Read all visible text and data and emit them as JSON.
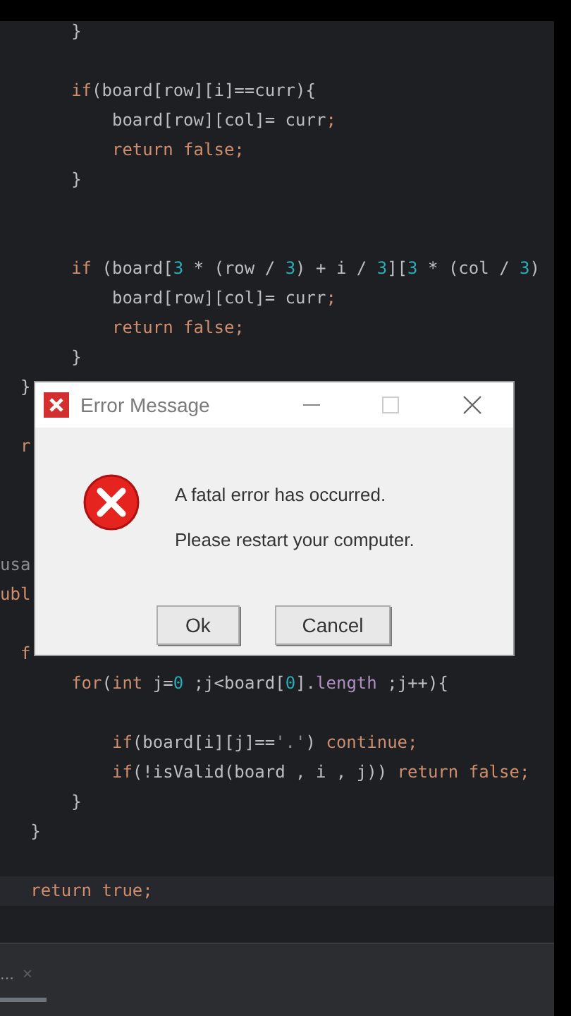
{
  "editor": {
    "lines": [
      {
        "current": false,
        "tokens": [
          {
            "text": "       }",
            "kind": "plain"
          }
        ]
      },
      {
        "current": false
      },
      {
        "current": false,
        "tokens": [
          {
            "text": "       if",
            "kind": "keyword"
          },
          {
            "text": "(board[row][i]==curr){",
            "kind": "plain"
          }
        ]
      },
      {
        "current": false,
        "tokens": [
          {
            "text": "           board[row][col]= curr",
            "kind": "plain"
          },
          {
            "text": ";",
            "kind": "keyword"
          }
        ]
      },
      {
        "current": false,
        "tokens": [
          {
            "text": "           return false;",
            "kind": "keyword"
          }
        ]
      },
      {
        "current": false,
        "tokens": [
          {
            "text": "       }",
            "kind": "plain"
          }
        ]
      },
      {
        "current": false
      },
      {
        "current": false
      },
      {
        "current": false,
        "tokens": [
          {
            "text": "       if",
            "kind": "keyword"
          },
          {
            "text": " (board[",
            "kind": "plain"
          },
          {
            "text": "3",
            "kind": "number"
          },
          {
            "text": " * (row / ",
            "kind": "plain"
          },
          {
            "text": "3",
            "kind": "number"
          },
          {
            "text": ") + i / ",
            "kind": "plain"
          },
          {
            "text": "3",
            "kind": "number"
          },
          {
            "text": "][",
            "kind": "plain"
          },
          {
            "text": "3",
            "kind": "number"
          },
          {
            "text": " * (col / ",
            "kind": "plain"
          },
          {
            "text": "3",
            "kind": "number"
          },
          {
            "text": ")",
            "kind": "plain"
          }
        ]
      },
      {
        "current": false,
        "tokens": [
          {
            "text": "           board[row][col]= curr",
            "kind": "plain"
          },
          {
            "text": ";",
            "kind": "keyword"
          }
        ]
      },
      {
        "current": false,
        "tokens": [
          {
            "text": "           return false;",
            "kind": "keyword"
          }
        ]
      },
      {
        "current": false,
        "tokens": [
          {
            "text": "       }",
            "kind": "plain"
          }
        ]
      },
      {
        "current": false,
        "tokens": [
          {
            "text": "  }",
            "kind": "plain"
          }
        ]
      },
      {
        "current": false
      },
      {
        "current": false,
        "tokens": [
          {
            "text": "  r",
            "kind": "keyword"
          }
        ]
      },
      {
        "current": false
      },
      {
        "current": false
      },
      {
        "current": false
      },
      {
        "current": false,
        "tokens": [
          {
            "text": "usa",
            "kind": "hint"
          }
        ]
      },
      {
        "current": false,
        "tokens": [
          {
            "text": "ubl",
            "kind": "keyword"
          }
        ]
      },
      {
        "current": false
      },
      {
        "current": false,
        "tokens": [
          {
            "text": "  f",
            "kind": "keyword"
          }
        ]
      },
      {
        "current": false,
        "tokens": [
          {
            "text": "       for",
            "kind": "keyword"
          },
          {
            "text": "(",
            "kind": "plain"
          },
          {
            "text": "int",
            "kind": "keyword"
          },
          {
            "text": " j=",
            "kind": "plain"
          },
          {
            "text": "0",
            "kind": "number"
          },
          {
            "text": " ;j<board[",
            "kind": "plain"
          },
          {
            "text": "0",
            "kind": "number"
          },
          {
            "text": "].",
            "kind": "plain"
          },
          {
            "text": "length",
            "kind": "field"
          },
          {
            "text": " ;j++){",
            "kind": "plain"
          }
        ]
      },
      {
        "current": false
      },
      {
        "current": false,
        "tokens": [
          {
            "text": "           if",
            "kind": "keyword"
          },
          {
            "text": "(board[i][j]==",
            "kind": "plain"
          },
          {
            "text": "'.'",
            "kind": "string"
          },
          {
            "text": ") ",
            "kind": "plain"
          },
          {
            "text": "continue;",
            "kind": "keyword"
          }
        ]
      },
      {
        "current": false,
        "tokens": [
          {
            "text": "           if",
            "kind": "keyword"
          },
          {
            "text": "(!isValid(board , i , j)) ",
            "kind": "plain"
          },
          {
            "text": "return false;",
            "kind": "keyword"
          }
        ]
      },
      {
        "current": false,
        "tokens": [
          {
            "text": "       }",
            "kind": "plain"
          }
        ]
      },
      {
        "current": false,
        "tokens": [
          {
            "text": "   }",
            "kind": "plain"
          }
        ]
      },
      {
        "current": false
      },
      {
        "current": true,
        "tokens": [
          {
            "text": "   return true;",
            "kind": "keyword"
          }
        ]
      }
    ]
  },
  "dialog": {
    "title": "Error Message",
    "messages": [
      "A fatal error has occurred.",
      "Please restart your computer."
    ],
    "buttons": [
      "Ok",
      "Cancel"
    ]
  },
  "bottom_panel": {
    "tab": "...",
    "close": "×"
  }
}
